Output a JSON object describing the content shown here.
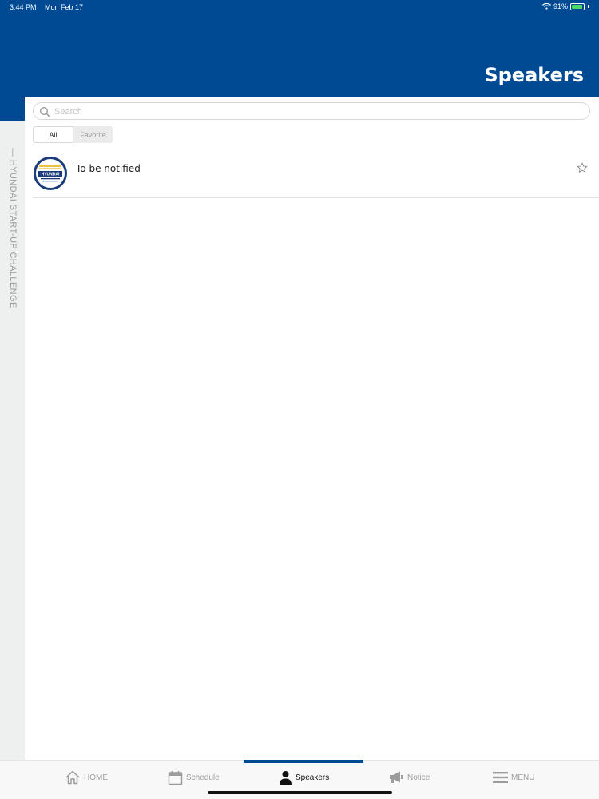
{
  "status_bar": {
    "time": "3:44 PM",
    "date": "Mon Feb 17",
    "battery": "91%"
  },
  "header": {
    "title": "Speakers"
  },
  "sidebar": {
    "vertical_label": "— HYUNDAI START-UP CHALLENGE"
  },
  "search": {
    "placeholder": "Search",
    "value": ""
  },
  "filter": {
    "all_label": "All",
    "favorite_label": "Favorite",
    "selected": "All"
  },
  "speakers": [
    {
      "name": "To be notified",
      "avatar_text": "HYUNDAI",
      "favorited": false
    }
  ],
  "tabs": [
    {
      "label": "HOME",
      "icon": "home-icon"
    },
    {
      "label": "Schedule",
      "icon": "calendar-icon"
    },
    {
      "label": "Speakers",
      "icon": "person-icon",
      "active": true
    },
    {
      "label": "Notice",
      "icon": "megaphone-icon"
    },
    {
      "label": "MENU",
      "icon": "hamburger-icon"
    }
  ],
  "colors": {
    "brand": "#004a94",
    "background": "#ffffff",
    "inactive_tab": "#9c9c9c"
  }
}
